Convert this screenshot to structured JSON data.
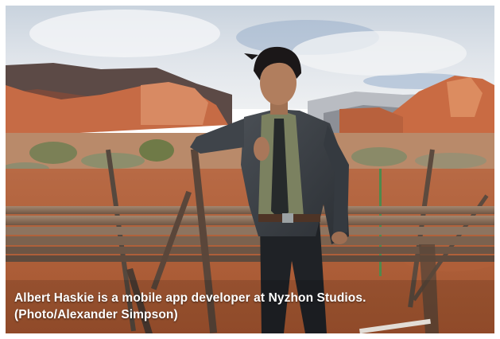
{
  "caption": {
    "line1": "Albert Haskie is a mobile app developer at Nyzhon Studios.",
    "line2": "(Photo/Alexander Simpson)"
  }
}
